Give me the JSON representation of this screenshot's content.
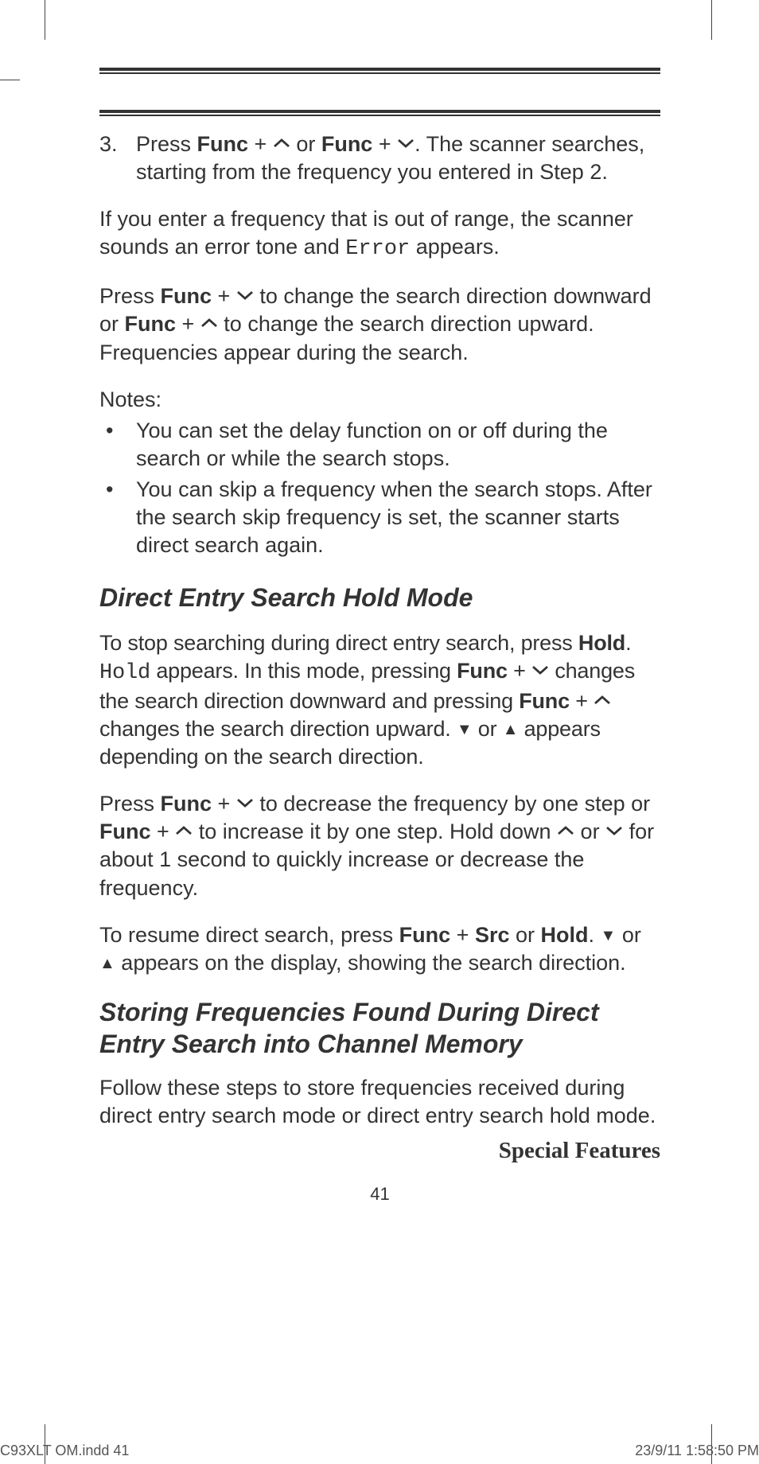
{
  "step3": {
    "marker": "3.",
    "text_a": "Press ",
    "func": "Func",
    "plus": " + ",
    "or": " or ",
    "text_b": ". The scanner searches, starting from the frequency you entered in Step 2."
  },
  "error_para": {
    "a": "If you enter a frequency that is out of range, the scanner sounds an error tone and ",
    "mono": "Error",
    "b": " appears."
  },
  "dir_para": {
    "a": "Press ",
    "func": "Func",
    "plus": " + ",
    "b": " to change the search direction down­ward or ",
    "c": " to change the search direction upward. Frequencies appear during the search."
  },
  "notes_label": "Notes:",
  "note1": "You can set the delay function on or off during the search or while the search stops.",
  "note2": "You can skip a frequency when the search stops. After the search skip frequency is set, the scan­ner starts direct search again.",
  "heading1": "Direct Entry Search Hold Mode",
  "hold_para": {
    "a": "To stop searching during direct entry search, press ",
    "hold": "Hold",
    "b": ". ",
    "mono": "Hold",
    "c": " appears. In this mode, pressing ",
    "func": "Func",
    "plus": " + ",
    "d": " changes the search direction downward and press­ing ",
    "e": " changes the search direction upward. ",
    "tri_down": "▼",
    "or": " or ",
    "tri_up": "▲",
    "f": "  appears depending on the search direction."
  },
  "step_para": {
    "a": "Press ",
    "func": "Func",
    "plus": " + ",
    "b": " to decrease the frequency by one step or ",
    "c": "  to increase it by one step. Hold down   ",
    "or": " or ",
    "d": " for about 1 second to quickly increase or decrease the frequency."
  },
  "resume_para": {
    "a": "To resume direct search, press ",
    "func": "Func",
    "plus": " + ",
    "src": "Src",
    "or_word": " or ",
    "hold": "Hold",
    "b": ". ",
    "tri_down": "▼",
    "or": " or ",
    "tri_up": "▲",
    "c": " appears on the display, showing the search direction."
  },
  "heading2": "Storing Frequencies Found During Direct Entry Search into Channel Memory",
  "store_para": "Follow these steps to store frequencies received during direct entry search mode or direct entry search hold mode.",
  "section_title": "Special Features",
  "page_number": "41",
  "footer_left": "C93XLT OM.indd   41",
  "footer_right": "23/9/11   1:58:50 PM"
}
